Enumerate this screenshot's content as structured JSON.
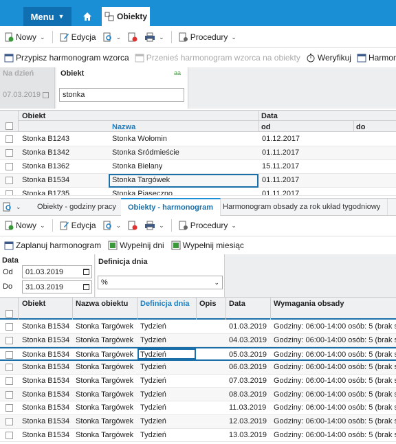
{
  "topbar": {
    "menu_label": "Menu",
    "tab_label": "Obiekty"
  },
  "toolbar1": {
    "new_label": "Nowy",
    "edit_label": "Edycja",
    "procedures_label": "Procedury"
  },
  "toolbar2": {
    "assign_label": "Przypisz harmonogram wzorca",
    "move_label": "Przenieś harmonogram wzorca na obiekty",
    "verify_label": "Weryfikuj",
    "schedule_label": "Harmonogram"
  },
  "filter1": {
    "date_label": "Na dzień",
    "date_value": "07.03.2019",
    "object_label": "Obiekt",
    "object_value": "stonka",
    "aa_label": "aa"
  },
  "grid1": {
    "group_object": "Obiekt",
    "group_data": "Data",
    "col_name": "Nazwa",
    "col_od": "od",
    "col_do": "do",
    "rows": [
      {
        "code": "Stonka B1243",
        "name": "Stonka Wołomin",
        "od": "01.12.2017"
      },
      {
        "code": "Stonka B1342",
        "name": "Stonka Śródmieście",
        "od": "01.11.2017"
      },
      {
        "code": "Stonka B1362",
        "name": "Stonka Bielany",
        "od": "15.11.2017"
      },
      {
        "code": "Stonka B1534",
        "name": "Stonka Targówek",
        "od": "01.11.2017"
      },
      {
        "code": "Stonka B1735",
        "name": "Stonka Piaseczno",
        "od": "01.11.2017"
      }
    ]
  },
  "tabs2": [
    "Obiekty - godziny pracy",
    "Obiekty - harmonogram",
    "Harmonogram obsady za rok układ tygodniowy"
  ],
  "toolbar3": {
    "new_label": "Nowy",
    "edit_label": "Edycja",
    "procedures_label": "Procedury"
  },
  "toolbar4": {
    "plan_label": "Zaplanuj harmonogram",
    "fill_days_label": "Wypełnij dni",
    "fill_month_label": "Wypełnij miesiąc"
  },
  "filter2": {
    "date_label": "Data",
    "from_label": "Od",
    "from_value": "01.03.2019",
    "to_label": "Do",
    "to_value": "31.03.2019",
    "def_label": "Definicja dnia",
    "def_value": "%"
  },
  "grid2": {
    "col_object": "Obiekt",
    "col_name": "Nazwa obiektu",
    "col_def": "Definicja dnia",
    "col_desc": "Opis",
    "col_date": "Data",
    "col_req": "Wymagania obsady",
    "rows": [
      {
        "code": "Stonka B1534",
        "name": "Stonka Targówek",
        "def": "Tydzień",
        "date": "01.03.2019",
        "req": "Godziny: 06:00-14:00 osób: 5 (brak s"
      },
      {
        "code": "Stonka B1534",
        "name": "Stonka Targówek",
        "def": "Tydzień",
        "date": "04.03.2019",
        "req": "Godziny: 06:00-14:00 osób: 5 (brak s"
      },
      {
        "code": "Stonka B1534",
        "name": "Stonka Targówek",
        "def": "Tydzień",
        "date": "05.03.2019",
        "req": "Godziny: 06:00-14:00 osób: 5 (brak s"
      },
      {
        "code": "Stonka B1534",
        "name": "Stonka Targówek",
        "def": "Tydzień",
        "date": "06.03.2019",
        "req": "Godziny: 06:00-14:00 osób: 5 (brak s"
      },
      {
        "code": "Stonka B1534",
        "name": "Stonka Targówek",
        "def": "Tydzień",
        "date": "07.03.2019",
        "req": "Godziny: 06:00-14:00 osób: 5 (brak s"
      },
      {
        "code": "Stonka B1534",
        "name": "Stonka Targówek",
        "def": "Tydzień",
        "date": "08.03.2019",
        "req": "Godziny: 06:00-14:00 osób: 5 (brak s"
      },
      {
        "code": "Stonka B1534",
        "name": "Stonka Targówek",
        "def": "Tydzień",
        "date": "11.03.2019",
        "req": "Godziny: 06:00-14:00 osób: 5 (brak s"
      },
      {
        "code": "Stonka B1534",
        "name": "Stonka Targówek",
        "def": "Tydzień",
        "date": "12.03.2019",
        "req": "Godziny: 06:00-14:00 osób: 5 (brak s"
      },
      {
        "code": "Stonka B1534",
        "name": "Stonka Targówek",
        "def": "Tydzień",
        "date": "13.03.2019",
        "req": "Godziny: 06:00-14:00 osób: 5 (brak s"
      }
    ]
  },
  "colors": {
    "accent": "#1b8fd6",
    "selection": "#1b6fa8"
  }
}
